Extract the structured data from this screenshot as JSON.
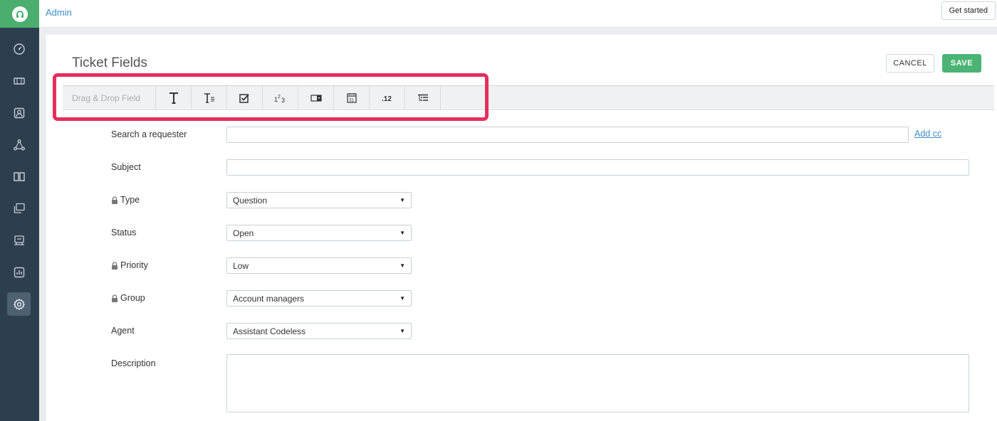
{
  "topbar": {
    "breadcrumb": "Admin",
    "get_started": "Get started"
  },
  "page": {
    "title": "Ticket Fields",
    "cancel": "CANCEL",
    "save": "SAVE"
  },
  "palette": {
    "label": "Drag & Drop Field",
    "items": [
      {
        "name": "single-line-text",
        "icon": "text-icon"
      },
      {
        "name": "paragraph",
        "icon": "paragraph-icon"
      },
      {
        "name": "checkbox",
        "icon": "checkbox-icon"
      },
      {
        "name": "number",
        "icon": "number-icon",
        "text": "123"
      },
      {
        "name": "dropdown",
        "icon": "dropdown-icon"
      },
      {
        "name": "date",
        "icon": "calendar-icon",
        "text": "31"
      },
      {
        "name": "decimal",
        "icon": "decimal-icon",
        "text": ".12"
      },
      {
        "name": "dependent",
        "icon": "list-icon"
      }
    ]
  },
  "form": {
    "requester": {
      "label": "Search a requester",
      "value": "",
      "add_cc": "Add cc"
    },
    "subject": {
      "label": "Subject",
      "value": ""
    },
    "type": {
      "label": "Type",
      "value": "Question",
      "locked": true
    },
    "status": {
      "label": "Status",
      "value": "Open",
      "locked": false
    },
    "priority": {
      "label": "Priority",
      "value": "Low",
      "locked": true
    },
    "group": {
      "label": "Group",
      "value": "Account managers",
      "locked": true
    },
    "agent": {
      "label": "Agent",
      "value": "Assistant Codeless",
      "locked": false
    },
    "description": {
      "label": "Description",
      "value": ""
    }
  },
  "colors": {
    "sidebar": "#2d3e4f",
    "brand": "#4bae6f",
    "save": "#4bb474",
    "highlight": "#e52e5c",
    "link": "#3e8dcb"
  }
}
